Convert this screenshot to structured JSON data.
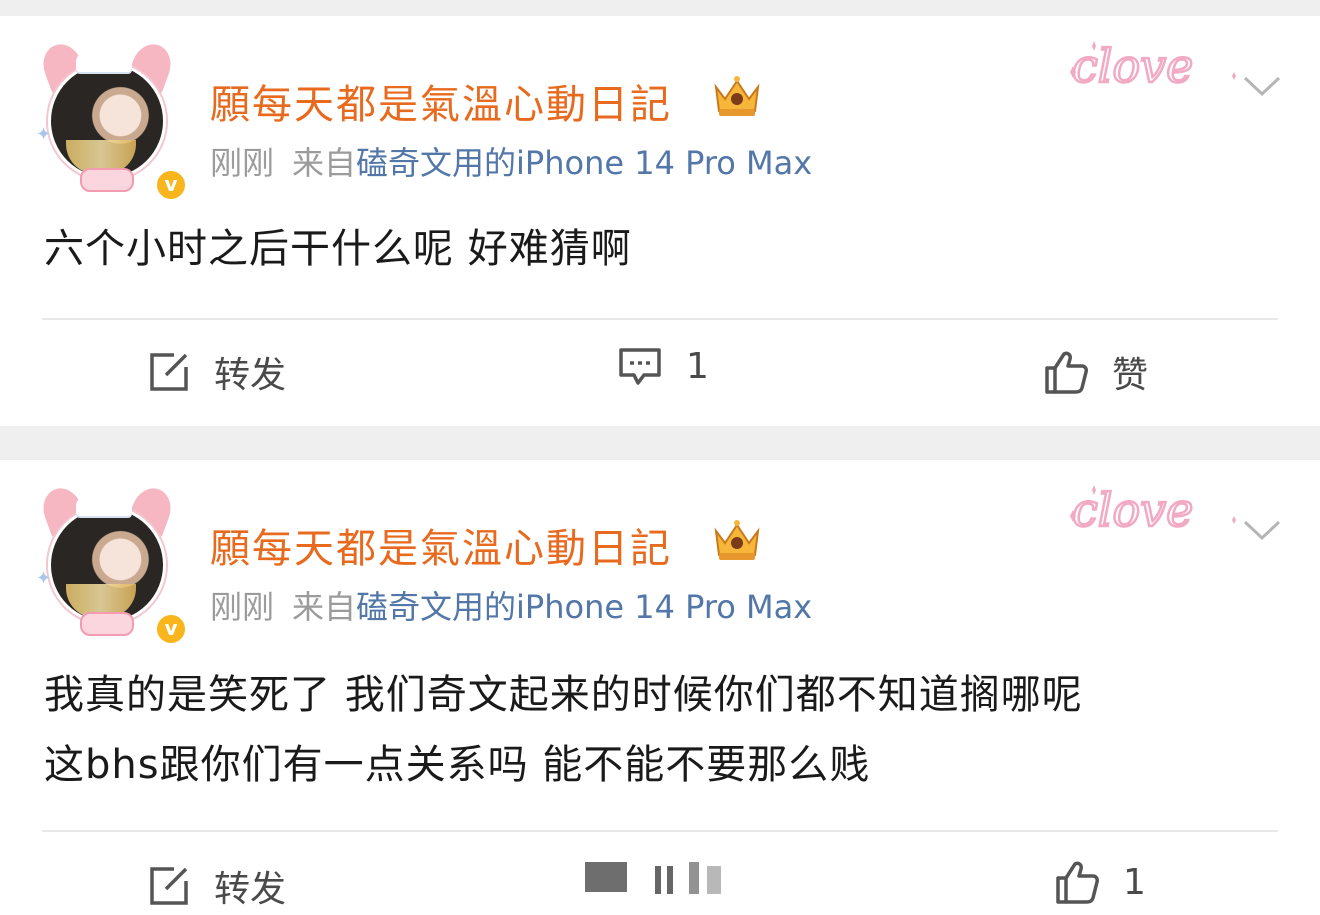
{
  "posts": [
    {
      "username": "願每天都是氣溫心動日記",
      "time": "刚刚",
      "source_prefix": "来自",
      "device": "磕奇文用的iPhone 14 Pro Max",
      "content_lines": [
        "六个小时之后干什么呢 好难猜啊"
      ],
      "repost_label": "转发",
      "comment_count": "1",
      "like_label": "赞"
    },
    {
      "username": "願每天都是氣溫心動日記",
      "time": "刚刚",
      "source_prefix": "来自",
      "device": "磕奇文用的iPhone 14 Pro Max",
      "content_lines": [
        "我真的是笑死了 我们奇文起来的时候你们都不知道搁哪呢",
        "这bhs跟你们有一点关系吗 能不能不要那么贱"
      ],
      "repost_label": "转发",
      "comment_label": "",
      "like_label": "1"
    }
  ],
  "icons": {
    "verified": "verified-badge",
    "crown": "vip-crown-icon",
    "decoration": "clove-sticker",
    "more": "chevron-down-icon",
    "repost": "share-icon",
    "comment": "comment-icon",
    "like": "thumbs-up-icon"
  },
  "colors": {
    "username": "#e86a1e",
    "device": "#5277a8",
    "meta": "#9b9b9b",
    "verified": "#f8b61c"
  }
}
